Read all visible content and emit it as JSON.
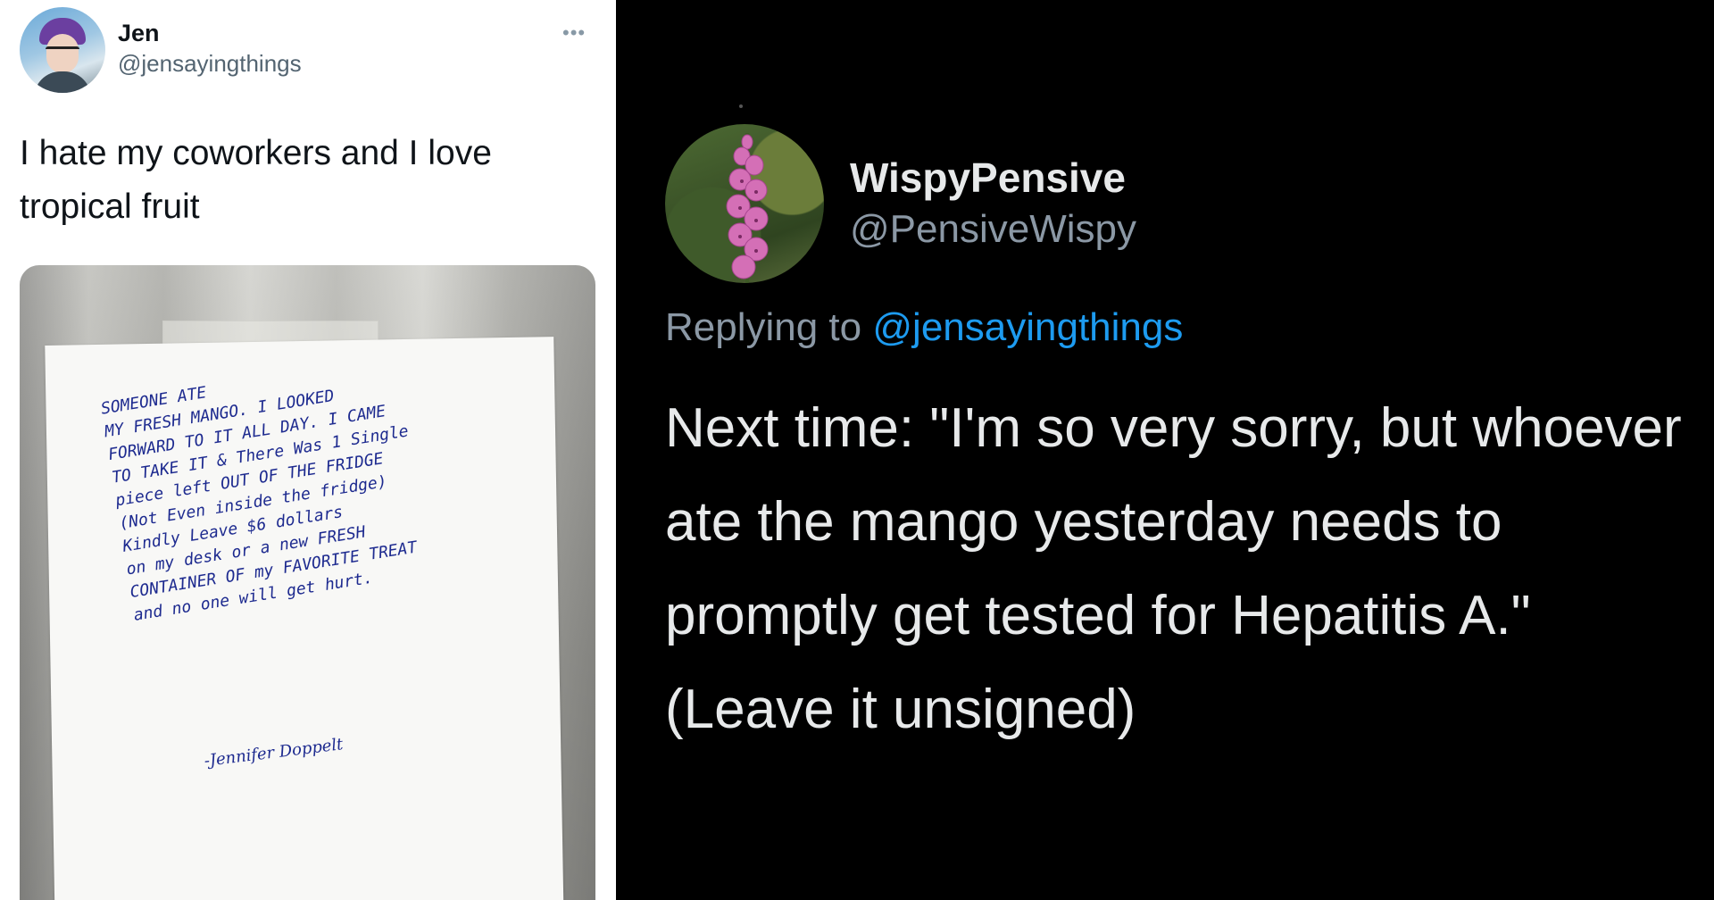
{
  "left_tweet": {
    "author_name": "Jen",
    "author_handle": "@jensayingthings",
    "more_icon": "more-horizontal-icon",
    "text": "I hate my coworkers and I love tropical fruit",
    "note": {
      "body": "SOMEONE ATE\nMY FRESH MANGO. I LOOKED\nFORWARD TO IT ALL DAY. I CAME\nTO TAKE IT & There Was 1 Single\npiece left OUT OF THE FRIDGE\n(Not Even inside the fridge)\nKindly Leave $6 dollars\non my desk or a new FRESH\nCONTAINER OF my FAVORITE TREAT\nand no one will get hurt.",
      "signature": "-Jennifer Doppelt"
    }
  },
  "right_tweet": {
    "author_name": "WispyPensive",
    "author_handle": "@PensiveWispy",
    "replying_prefix": "Replying to",
    "replying_mention": "@jensayingthings",
    "text": "Next time: \"I'm so very sorry, but whoever ate the mango yesterday needs to promptly get tested for Hepatitis A.\" (Leave it unsigned)"
  },
  "colors": {
    "mention_blue": "#1d9bf0",
    "note_ink": "#1d2a8f",
    "dark_bg": "#000000",
    "light_bg": "#ffffff"
  }
}
